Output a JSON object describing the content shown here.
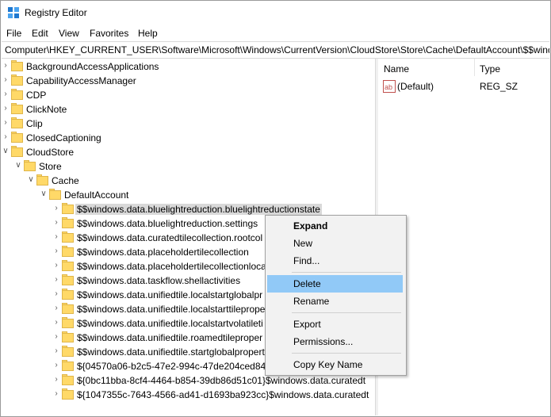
{
  "window": {
    "title": "Registry Editor"
  },
  "menu": [
    "File",
    "Edit",
    "View",
    "Favorites",
    "Help"
  ],
  "address": "Computer\\HKEY_CURRENT_USER\\Software\\Microsoft\\Windows\\CurrentVersion\\CloudStore\\Store\\Cache\\DefaultAccount\\$$windows.",
  "tree": [
    {
      "label": "BackgroundAccessApplications",
      "arrow": ">"
    },
    {
      "label": "CapabilityAccessManager",
      "arrow": ">"
    },
    {
      "label": "CDP",
      "arrow": ">"
    },
    {
      "label": "ClickNote",
      "arrow": ">"
    },
    {
      "label": "Clip",
      "arrow": ">"
    },
    {
      "label": "ClosedCaptioning",
      "arrow": ">"
    },
    {
      "label": "CloudStore",
      "arrow": "v"
    },
    {
      "label": "Store",
      "arrow": "v"
    },
    {
      "label": "Cache",
      "arrow": "v"
    },
    {
      "label": "DefaultAccount",
      "arrow": "v"
    },
    {
      "label": "$$windows.data.bluelightreduction.bluelightreductionstate",
      "arrow": ">"
    },
    {
      "label": "$$windows.data.bluelightreduction.settings",
      "arrow": ">"
    },
    {
      "label": "$$windows.data.curatedtilecollection.rootcol",
      "arrow": ">"
    },
    {
      "label": "$$windows.data.placeholdertilecollection",
      "arrow": ">"
    },
    {
      "label": "$$windows.data.placeholdertilecollectionloca",
      "arrow": ">"
    },
    {
      "label": "$$windows.data.taskflow.shellactivities",
      "arrow": ">"
    },
    {
      "label": "$$windows.data.unifiedtile.localstartglobalpr",
      "arrow": ">"
    },
    {
      "label": "$$windows.data.unifiedtile.localstarttileprope",
      "arrow": ">"
    },
    {
      "label": "$$windows.data.unifiedtile.localstartvolatileti",
      "arrow": ">"
    },
    {
      "label": "$$windows.data.unifiedtile.roamedtileproper",
      "arrow": ">"
    },
    {
      "label": "$$windows.data.unifiedtile.startglobalpropert",
      "arrow": ">"
    },
    {
      "label": "${04570a06-b2c5-47e2-994c-47de204ced84}$",
      "arrow": ">"
    },
    {
      "label": "${0bc11bba-8cf4-4464-b854-39db86d51c01}$windows.data.curatedt",
      "arrow": ">"
    },
    {
      "label": "${1047355c-7643-4566-ad41-d1693ba923cc}$windows.data.curatedt",
      "arrow": ">"
    }
  ],
  "right_pane": {
    "headers": {
      "name": "Name",
      "type": "Type"
    },
    "values": [
      {
        "name": "(Default)",
        "type": "REG_SZ",
        "icon": "ab"
      }
    ]
  },
  "context_menu": {
    "items": [
      {
        "label": "Expand",
        "bold": true
      },
      {
        "label": "New"
      },
      {
        "label": "Find..."
      },
      {
        "label": "Delete",
        "highlighted": true
      },
      {
        "label": "Rename"
      },
      {
        "label": "Export"
      },
      {
        "label": "Permissions..."
      },
      {
        "label": "Copy Key Name"
      }
    ]
  },
  "colors": {
    "highlight": "#91c9f7",
    "folder": "#ffd968",
    "selection": "#d9d9d9"
  }
}
